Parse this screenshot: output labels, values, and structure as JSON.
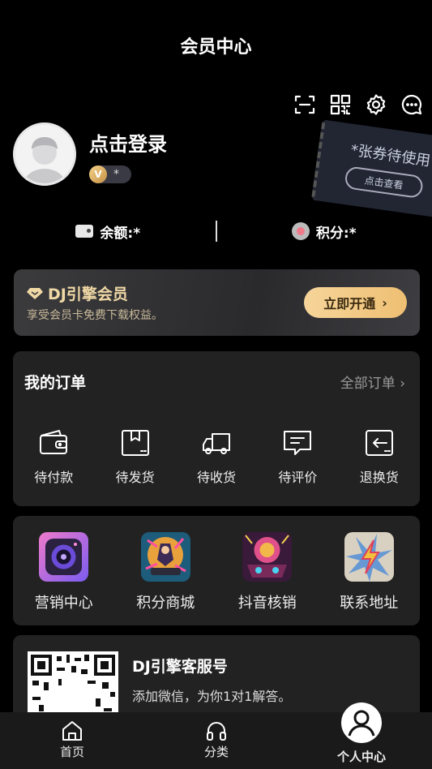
{
  "header": {
    "title": "会员中心"
  },
  "top_icons": [
    "scan-icon",
    "qrcode-icon",
    "gear-icon",
    "message-icon"
  ],
  "user": {
    "login_text": "点击登录",
    "vip_badge_letter": "V",
    "vip_level": "*"
  },
  "coupon": {
    "title": "*张券待使用",
    "button": "点击查看"
  },
  "stats": {
    "balance_label": "余额:*",
    "points_label": "积分:*"
  },
  "vip_card": {
    "title": "DJ引擎会员",
    "subtitle": "享受会员卡免费下载权益。",
    "button": "立即开通",
    "button_arrow": "›"
  },
  "orders": {
    "title": "我的订单",
    "all_label": "全部订单",
    "all_arrow": "›",
    "items": [
      {
        "label": "待付款",
        "icon": "wallet-icon"
      },
      {
        "label": "待发货",
        "icon": "package-icon"
      },
      {
        "label": "待收货",
        "icon": "truck-icon"
      },
      {
        "label": "待评价",
        "icon": "comment-icon"
      },
      {
        "label": "退换货",
        "icon": "return-icon"
      }
    ]
  },
  "tools": [
    {
      "label": "营销中心",
      "icon": "speaker-app-icon"
    },
    {
      "label": "积分商城",
      "icon": "dj-art-icon"
    },
    {
      "label": "抖音核销",
      "icon": "dj-console-art-icon"
    },
    {
      "label": "联系地址",
      "icon": "lightning-art-icon"
    }
  ],
  "service": {
    "title": "DJ引擎客服号",
    "subtitle": "添加微信，为你1对1解答。"
  },
  "tabbar": {
    "tabs": [
      {
        "label": "首页",
        "icon": "home-icon"
      },
      {
        "label": "分类",
        "icon": "headphones-icon"
      },
      {
        "label": "个人中心",
        "icon": "user-icon",
        "active": true
      }
    ]
  },
  "colors": {
    "background": "#000000",
    "card": "#222222",
    "gold": "#f1d9a6",
    "gold_button": "#f6d59a"
  }
}
